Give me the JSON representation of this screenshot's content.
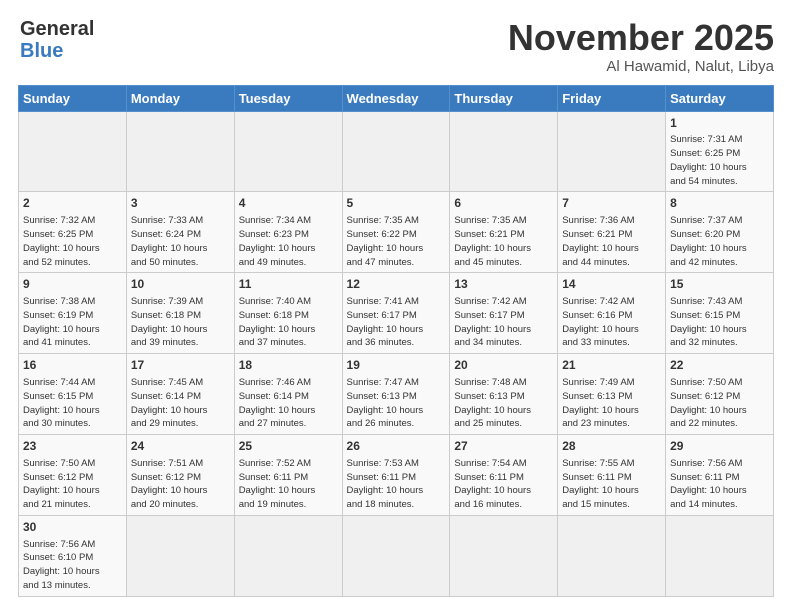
{
  "header": {
    "logo_general": "General",
    "logo_blue": "Blue",
    "month_title": "November 2025",
    "location": "Al Hawamid, Nalut, Libya"
  },
  "weekdays": [
    "Sunday",
    "Monday",
    "Tuesday",
    "Wednesday",
    "Thursday",
    "Friday",
    "Saturday"
  ],
  "weeks": [
    [
      {
        "day": "",
        "info": ""
      },
      {
        "day": "",
        "info": ""
      },
      {
        "day": "",
        "info": ""
      },
      {
        "day": "",
        "info": ""
      },
      {
        "day": "",
        "info": ""
      },
      {
        "day": "",
        "info": ""
      },
      {
        "day": "1",
        "info": "Sunrise: 7:31 AM\nSunset: 6:25 PM\nDaylight: 10 hours\nand 54 minutes."
      }
    ],
    [
      {
        "day": "2",
        "info": "Sunrise: 7:32 AM\nSunset: 6:25 PM\nDaylight: 10 hours\nand 52 minutes."
      },
      {
        "day": "3",
        "info": "Sunrise: 7:33 AM\nSunset: 6:24 PM\nDaylight: 10 hours\nand 50 minutes."
      },
      {
        "day": "4",
        "info": "Sunrise: 7:34 AM\nSunset: 6:23 PM\nDaylight: 10 hours\nand 49 minutes."
      },
      {
        "day": "5",
        "info": "Sunrise: 7:35 AM\nSunset: 6:22 PM\nDaylight: 10 hours\nand 47 minutes."
      },
      {
        "day": "6",
        "info": "Sunrise: 7:35 AM\nSunset: 6:21 PM\nDaylight: 10 hours\nand 45 minutes."
      },
      {
        "day": "7",
        "info": "Sunrise: 7:36 AM\nSunset: 6:21 PM\nDaylight: 10 hours\nand 44 minutes."
      },
      {
        "day": "8",
        "info": "Sunrise: 7:37 AM\nSunset: 6:20 PM\nDaylight: 10 hours\nand 42 minutes."
      }
    ],
    [
      {
        "day": "9",
        "info": "Sunrise: 7:38 AM\nSunset: 6:19 PM\nDaylight: 10 hours\nand 41 minutes."
      },
      {
        "day": "10",
        "info": "Sunrise: 7:39 AM\nSunset: 6:18 PM\nDaylight: 10 hours\nand 39 minutes."
      },
      {
        "day": "11",
        "info": "Sunrise: 7:40 AM\nSunset: 6:18 PM\nDaylight: 10 hours\nand 37 minutes."
      },
      {
        "day": "12",
        "info": "Sunrise: 7:41 AM\nSunset: 6:17 PM\nDaylight: 10 hours\nand 36 minutes."
      },
      {
        "day": "13",
        "info": "Sunrise: 7:42 AM\nSunset: 6:17 PM\nDaylight: 10 hours\nand 34 minutes."
      },
      {
        "day": "14",
        "info": "Sunrise: 7:42 AM\nSunset: 6:16 PM\nDaylight: 10 hours\nand 33 minutes."
      },
      {
        "day": "15",
        "info": "Sunrise: 7:43 AM\nSunset: 6:15 PM\nDaylight: 10 hours\nand 32 minutes."
      }
    ],
    [
      {
        "day": "16",
        "info": "Sunrise: 7:44 AM\nSunset: 6:15 PM\nDaylight: 10 hours\nand 30 minutes."
      },
      {
        "day": "17",
        "info": "Sunrise: 7:45 AM\nSunset: 6:14 PM\nDaylight: 10 hours\nand 29 minutes."
      },
      {
        "day": "18",
        "info": "Sunrise: 7:46 AM\nSunset: 6:14 PM\nDaylight: 10 hours\nand 27 minutes."
      },
      {
        "day": "19",
        "info": "Sunrise: 7:47 AM\nSunset: 6:13 PM\nDaylight: 10 hours\nand 26 minutes."
      },
      {
        "day": "20",
        "info": "Sunrise: 7:48 AM\nSunset: 6:13 PM\nDaylight: 10 hours\nand 25 minutes."
      },
      {
        "day": "21",
        "info": "Sunrise: 7:49 AM\nSunset: 6:13 PM\nDaylight: 10 hours\nand 23 minutes."
      },
      {
        "day": "22",
        "info": "Sunrise: 7:50 AM\nSunset: 6:12 PM\nDaylight: 10 hours\nand 22 minutes."
      }
    ],
    [
      {
        "day": "23",
        "info": "Sunrise: 7:50 AM\nSunset: 6:12 PM\nDaylight: 10 hours\nand 21 minutes."
      },
      {
        "day": "24",
        "info": "Sunrise: 7:51 AM\nSunset: 6:12 PM\nDaylight: 10 hours\nand 20 minutes."
      },
      {
        "day": "25",
        "info": "Sunrise: 7:52 AM\nSunset: 6:11 PM\nDaylight: 10 hours\nand 19 minutes."
      },
      {
        "day": "26",
        "info": "Sunrise: 7:53 AM\nSunset: 6:11 PM\nDaylight: 10 hours\nand 18 minutes."
      },
      {
        "day": "27",
        "info": "Sunrise: 7:54 AM\nSunset: 6:11 PM\nDaylight: 10 hours\nand 16 minutes."
      },
      {
        "day": "28",
        "info": "Sunrise: 7:55 AM\nSunset: 6:11 PM\nDaylight: 10 hours\nand 15 minutes."
      },
      {
        "day": "29",
        "info": "Sunrise: 7:56 AM\nSunset: 6:11 PM\nDaylight: 10 hours\nand 14 minutes."
      }
    ],
    [
      {
        "day": "30",
        "info": "Sunrise: 7:56 AM\nSunset: 6:10 PM\nDaylight: 10 hours\nand 13 minutes."
      },
      {
        "day": "",
        "info": ""
      },
      {
        "day": "",
        "info": ""
      },
      {
        "day": "",
        "info": ""
      },
      {
        "day": "",
        "info": ""
      },
      {
        "day": "",
        "info": ""
      },
      {
        "day": "",
        "info": ""
      }
    ]
  ]
}
